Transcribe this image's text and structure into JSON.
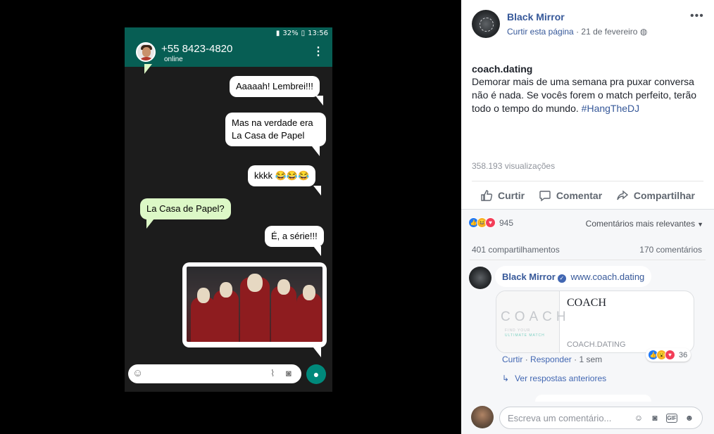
{
  "phone": {
    "status": {
      "battery": "32%",
      "time": "13:56"
    },
    "contact": {
      "name": "+55 8423-4820",
      "status": "online"
    },
    "messages": [
      {
        "text": "Aaaaah! Lembrei!!!",
        "side": "out"
      },
      {
        "text": "Mas na verdade era La Casa de Papel",
        "side": "out"
      },
      {
        "text": "kkkk 😂😂😂",
        "side": "out"
      },
      {
        "text": "La Casa de Papel?",
        "side": "in"
      },
      {
        "text": "É, a série!!!",
        "side": "out"
      }
    ]
  },
  "post": {
    "page_name": "Black Mirror",
    "like_page": "Curtir esta página",
    "date": "21 de fevereiro",
    "title": "coach.dating",
    "body": "Demorar mais de uma semana pra puxar conversa não é nada. Se vocês forem o match perfeito, terão todo o tempo do mundo.",
    "hashtag": "#HangTheDJ",
    "views": "358.193 visualizações",
    "actions": {
      "like": "Curtir",
      "comment": "Comentar",
      "share": "Compartilhar"
    },
    "reaction_count": "945",
    "sort_label": "Comentários mais relevantes",
    "shares": "401 compartilhamentos",
    "comments": "170 comentários"
  },
  "comment": {
    "author": "Black Mirror",
    "link": "www.coach.dating",
    "card": {
      "brand": "COACH",
      "tagline_a": "FIND YOUR",
      "tagline_b": "ULTIMATE MATCH",
      "title": "COACH",
      "domain": "COACH.DATING"
    },
    "like": "Curtir",
    "reply": "Responder",
    "time": "1 sem",
    "reaction_count": "36",
    "view_replies": "Ver respostas anteriores"
  },
  "composer": {
    "placeholder": "Escreva um comentário..."
  },
  "colors": {
    "whatsapp_green": "#075e54",
    "fb_blue": "#365899",
    "bubble_in": "#dcf8c6"
  },
  "icons": [
    "signal-icon",
    "battery-icon",
    "menu-dots-icon",
    "emoji-icon",
    "paperclip-icon",
    "camera-icon",
    "mic-icon",
    "like-icon",
    "comment-icon",
    "share-icon",
    "globe-icon",
    "verified-icon",
    "gif-icon",
    "sticker-icon"
  ]
}
